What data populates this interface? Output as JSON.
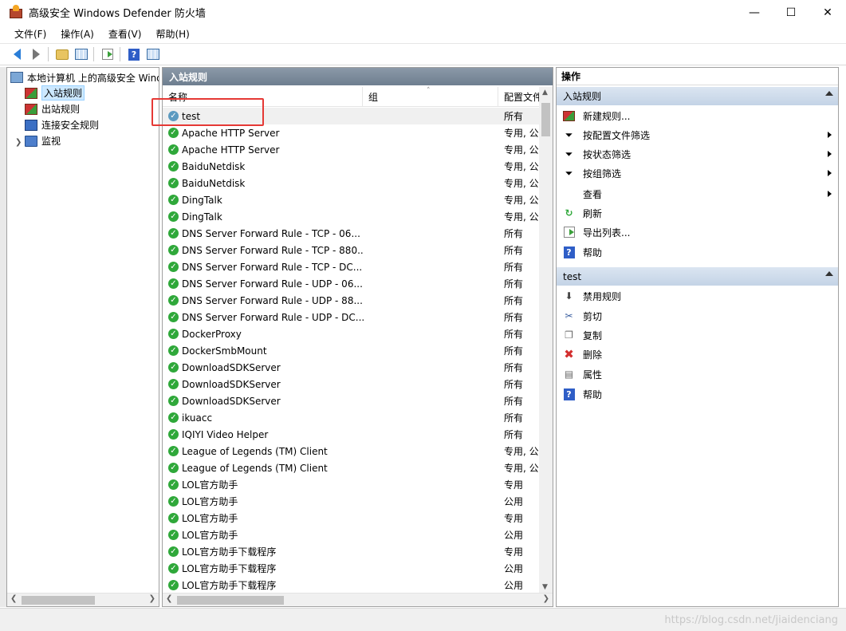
{
  "window": {
    "title": "高级安全 Windows Defender 防火墙",
    "minimize": "—",
    "maximize": "☐",
    "close": "✕"
  },
  "menu": [
    "文件(F)",
    "操作(A)",
    "查看(V)",
    "帮助(H)"
  ],
  "tree": {
    "root": "本地计算机 上的高级安全 Windows Defender 防火墙",
    "items": [
      "入站规则",
      "出站规则",
      "连接安全规则",
      "监视"
    ]
  },
  "rules": {
    "section_title": "入站规则",
    "columns": [
      "名称",
      "组",
      "配置文件"
    ],
    "rows": [
      {
        "name": "test",
        "profile": "所有"
      },
      {
        "name": "Apache HTTP Server",
        "profile": "专用, 公用"
      },
      {
        "name": "Apache HTTP Server",
        "profile": "专用, 公用"
      },
      {
        "name": "BaiduNetdisk",
        "profile": "专用, 公用"
      },
      {
        "name": "BaiduNetdisk",
        "profile": "专用, 公用"
      },
      {
        "name": "DingTalk",
        "profile": "专用, 公用"
      },
      {
        "name": "DingTalk",
        "profile": "专用, 公用"
      },
      {
        "name": "DNS Server Forward Rule - TCP - 06...",
        "profile": "所有"
      },
      {
        "name": "DNS Server Forward Rule - TCP - 880...",
        "profile": "所有"
      },
      {
        "name": "DNS Server Forward Rule - TCP - DC...",
        "profile": "所有"
      },
      {
        "name": "DNS Server Forward Rule - UDP - 06...",
        "profile": "所有"
      },
      {
        "name": "DNS Server Forward Rule - UDP - 88...",
        "profile": "所有"
      },
      {
        "name": "DNS Server Forward Rule - UDP - DC...",
        "profile": "所有"
      },
      {
        "name": "DockerProxy",
        "profile": "所有"
      },
      {
        "name": "DockerSmbMount",
        "profile": "所有"
      },
      {
        "name": "DownloadSDKServer",
        "profile": "所有"
      },
      {
        "name": "DownloadSDKServer",
        "profile": "所有"
      },
      {
        "name": "DownloadSDKServer",
        "profile": "所有"
      },
      {
        "name": "ikuacc",
        "profile": "所有"
      },
      {
        "name": "IQIYI Video Helper",
        "profile": "所有"
      },
      {
        "name": "League of Legends (TM) Client",
        "profile": "专用, 公用"
      },
      {
        "name": "League of Legends (TM) Client",
        "profile": "专用, 公用"
      },
      {
        "name": "LOL官方助手",
        "profile": "专用"
      },
      {
        "name": "LOL官方助手",
        "profile": "公用"
      },
      {
        "name": "LOL官方助手",
        "profile": "专用"
      },
      {
        "name": "LOL官方助手",
        "profile": "公用"
      },
      {
        "name": "LOL官方助手下载程序",
        "profile": "专用"
      },
      {
        "name": "LOL官方助手下载程序",
        "profile": "公用"
      },
      {
        "name": "LOL官方助手下载程序",
        "profile": "公用"
      }
    ]
  },
  "actions": {
    "header": "操作",
    "group1": {
      "title": "入站规则",
      "items": [
        "新建规则...",
        "按配置文件筛选",
        "按状态筛选",
        "按组筛选",
        "查看",
        "刷新",
        "导出列表...",
        "帮助"
      ]
    },
    "group2": {
      "title": "test",
      "items": [
        "禁用规则",
        "剪切",
        "复制",
        "删除",
        "属性",
        "帮助"
      ]
    }
  },
  "watermark": "https://blog.csdn.net/jiaidenciang",
  "colors": {
    "selection_bg": "#cce8ff",
    "header_bg": "#7a8a9a",
    "group_bg": "#c9d7e8",
    "ok_green": "#2fa83a",
    "annotation_red": "#e53935"
  }
}
